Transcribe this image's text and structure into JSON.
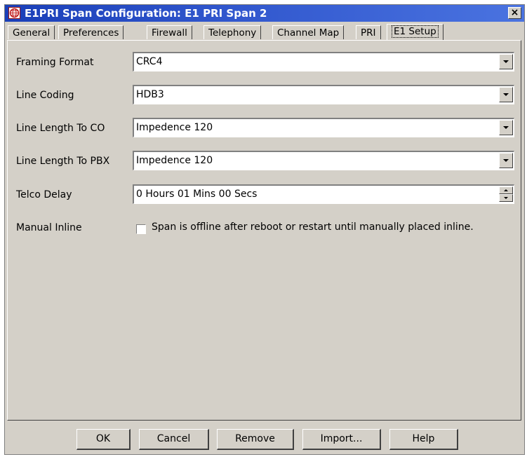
{
  "window": {
    "title": "E1PRI Span Configuration: E1 PRI Span 2",
    "close_label": "×"
  },
  "tabs": [
    {
      "label": "General"
    },
    {
      "label": "Preferences"
    },
    {
      "label": "Firewall"
    },
    {
      "label": "Telephony"
    },
    {
      "label": "Channel Map"
    },
    {
      "label": "PRI"
    },
    {
      "label": "E1 Setup",
      "active": true
    }
  ],
  "form": {
    "framing_format": {
      "label": "Framing Format",
      "value": "CRC4"
    },
    "line_coding": {
      "label": "Line Coding",
      "value": "HDB3"
    },
    "line_length_co": {
      "label": "Line Length To CO",
      "value": "Impedence 120"
    },
    "line_length_pbx": {
      "label": "Line Length To PBX",
      "value": "Impedence 120"
    },
    "telco_delay": {
      "label": "Telco Delay",
      "value": "0 Hours 01 Mins 00 Secs"
    },
    "manual_inline": {
      "label": "Manual Inline",
      "checkbox_label": "Span is offline after reboot or restart until manually placed inline.",
      "checked": false
    }
  },
  "buttons": {
    "ok": "OK",
    "cancel": "Cancel",
    "remove": "Remove",
    "import": "Import...",
    "help": "Help"
  },
  "colors": {
    "titlebar": "#1a3fb8",
    "dialog_bg": "#d4d0c8"
  }
}
